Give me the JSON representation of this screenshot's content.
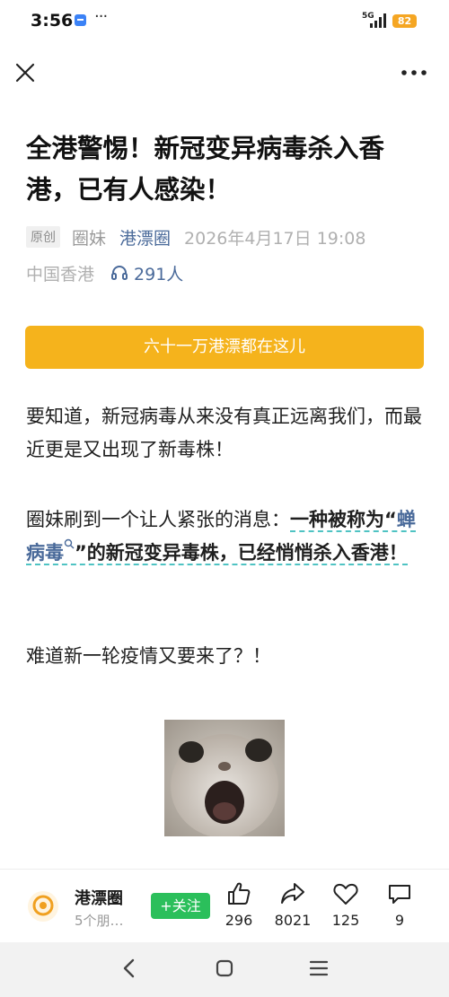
{
  "status_bar": {
    "time": "3:56",
    "dots": "···",
    "network": "5G",
    "battery": "82"
  },
  "icons": {
    "close": "close-icon",
    "more": "more-dots-icon",
    "listen": "headphones-icon",
    "keyword_search": "search-icon",
    "like": "thumbs-up-icon",
    "share": "share-arrow-icon",
    "favorite": "heart-icon",
    "comment": "comment-bubble-icon",
    "nav_back": "back-icon",
    "nav_home": "home-icon",
    "nav_menu": "menu-icon"
  },
  "article": {
    "title": "全港警惕！新冠变异病毒杀入香港，已有人感染！",
    "original_tag": "原创",
    "author": "圈妹",
    "source": "港漂圈",
    "publish_time": "2026年4月17日 19:08",
    "location": "中国香港",
    "listen_count": "291人",
    "banner": "六十一万港漂都在这儿",
    "p1": "要知道，新冠病毒从来没有真正远离我们，而最近更是又出现了新毒株！",
    "p2_prefix": "圈妹刷到一个让人紧张的消息：",
    "p2_hl_a": "一种被称为“",
    "p2_keyword": "蝉病毒",
    "p2_hl_b": "”的新冠变异毒株，已经悄悄杀入香港！",
    "p3": "难道新一轮疫情又要来了？！"
  },
  "account": {
    "name": "港漂圈",
    "subtitle": "5个朋…",
    "follow_label": "+关注"
  },
  "actions": {
    "like_count": "296",
    "share_count": "8021",
    "favorite_count": "125",
    "comment_count": "9"
  },
  "colors": {
    "accent_orange": "#f5b31c",
    "link_blue": "#4a6a9a",
    "follow_green": "#2bbf5b",
    "highlight_teal": "#4fc3c3"
  }
}
